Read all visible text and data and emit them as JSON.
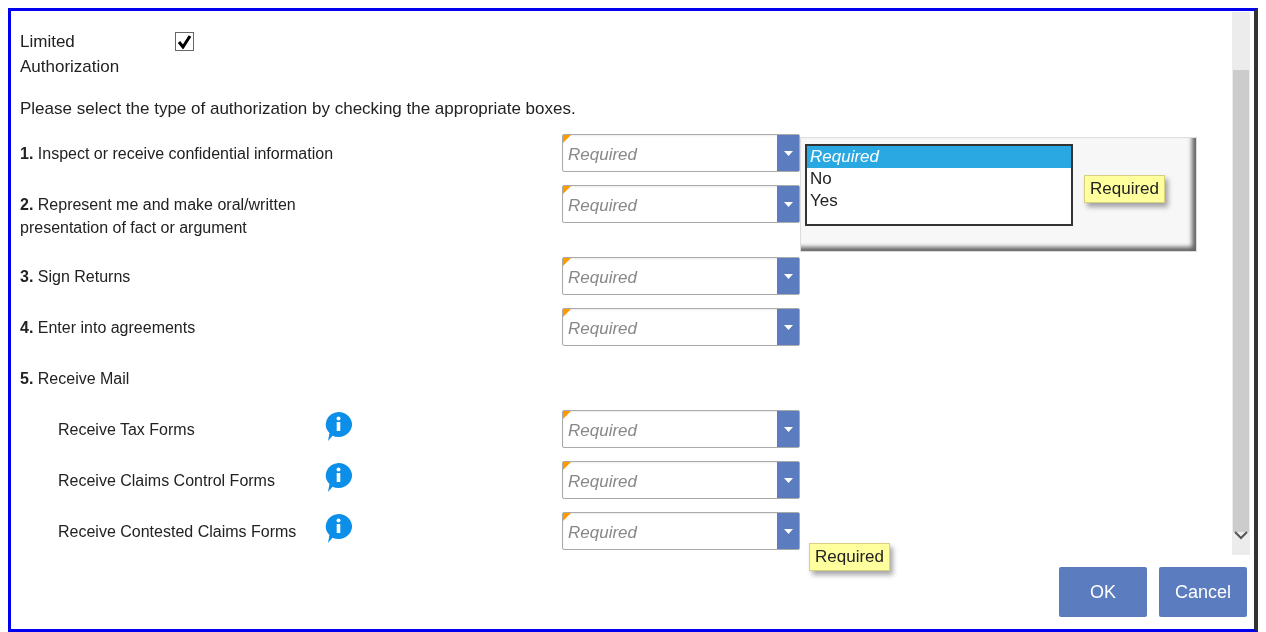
{
  "authorization": {
    "label": "Limited Authorization",
    "checked": true
  },
  "instruction": "Please select the type of authorization by checking the appropriate boxes.",
  "items": [
    {
      "kind": "select",
      "number": "1.",
      "label": "Inspect or receive confidential information",
      "placeholder": "Required"
    },
    {
      "kind": "select",
      "number": "2.",
      "label": "Represent me and make oral/written presentation of fact or argument",
      "placeholder": "Required"
    },
    {
      "kind": "select",
      "number": "3.",
      "label": "Sign Returns",
      "placeholder": "Required"
    },
    {
      "kind": "select",
      "number": "4.",
      "label": "Enter into agreements",
      "placeholder": "Required"
    },
    {
      "kind": "heading",
      "number": "5.",
      "label": "Receive Mail"
    },
    {
      "kind": "subselect",
      "label": "Receive Tax Forms",
      "placeholder": "Required"
    },
    {
      "kind": "subselect",
      "label": "Receive Claims Control Forms",
      "placeholder": "Required"
    },
    {
      "kind": "subselect",
      "label": "Receive Contested Claims Forms",
      "placeholder": "Required",
      "tooltip": "Required"
    }
  ],
  "dropdown_popup": {
    "options": [
      {
        "label": "Required",
        "selected": true
      },
      {
        "label": "No",
        "selected": false
      },
      {
        "label": "Yes",
        "selected": false
      }
    ],
    "tooltip": "Required"
  },
  "buttons": [
    "OK",
    "Cancel"
  ]
}
